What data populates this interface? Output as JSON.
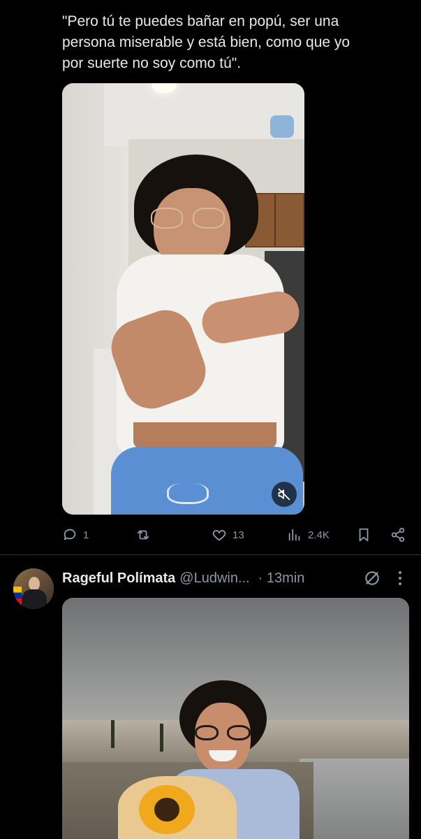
{
  "tweet_text": "\"Pero tú te puedes bañar en popú, ser una\npersona miserable y está bien, como que yo\npor suerte no soy como tú\".",
  "video": {
    "mute_icon": "muted-speaker-icon"
  },
  "actions": {
    "reply": {
      "icon": "reply-icon",
      "count": "1"
    },
    "repost": {
      "icon": "repost-icon",
      "count": ""
    },
    "like": {
      "icon": "heart-icon",
      "count": "13"
    },
    "views": {
      "icon": "views-icon",
      "count": "2.4K"
    },
    "bookmark": {
      "icon": "bookmark-icon"
    },
    "share": {
      "icon": "share-icon"
    }
  },
  "next_tweet": {
    "author_name": "Rageful Polímata",
    "handle": "@Ludwin...",
    "time": "· 13min",
    "grok_icon": "grok-icon",
    "more_icon": "more-icon"
  },
  "colors": {
    "background": "#000000",
    "text": "#e7e9ea",
    "muted": "#8b98a5",
    "divider": "#2f3336"
  }
}
